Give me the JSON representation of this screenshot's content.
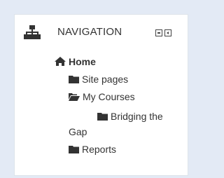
{
  "block": {
    "title": "NAVIGATION",
    "controls": [
      "minimize",
      "dock"
    ]
  },
  "tree": {
    "home": "Home",
    "site_pages": "Site pages",
    "my_courses": "My Courses",
    "course_line1": "Bridging the",
    "course_line2": "Gap",
    "reports": "Reports"
  },
  "icons": {
    "block": "sitemap-icon",
    "home": "home-icon",
    "folder": "folder-icon",
    "folder_open": "folder-open-icon"
  },
  "colors": {
    "page_bg": "#e3eaf5",
    "block_bg": "#ffffff",
    "text": "#333333",
    "icon": "#333333"
  }
}
